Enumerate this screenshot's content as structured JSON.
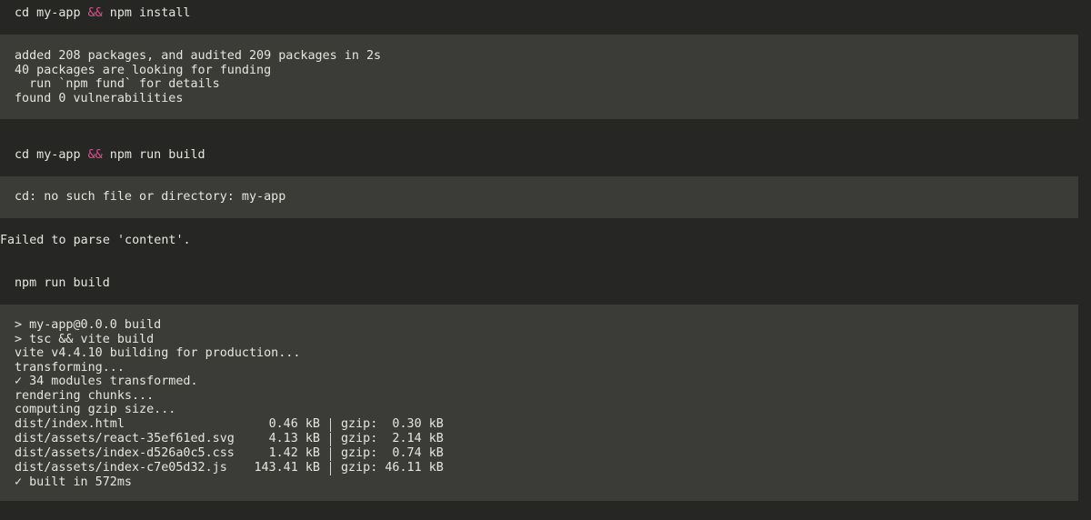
{
  "block1": {
    "cmd_pre": "cd my-app ",
    "cmd_amp": "&&",
    "cmd_post": " npm install",
    "output": [
      "added 208 packages, and audited 209 packages in 2s",
      "40 packages are looking for funding",
      "  run `npm fund` for details",
      "found 0 vulnerabilities"
    ]
  },
  "block2": {
    "cmd_pre": "cd my-app ",
    "cmd_amp": "&&",
    "cmd_post": " npm run build",
    "output": [
      "cd: no such file or directory: my-app"
    ]
  },
  "error_message": "Failed to parse 'content'.",
  "block3": {
    "cmd": "npm run build",
    "output_head": [
      "> my-app@0.0.0 build",
      "> tsc && vite build",
      "vite v4.4.10 building for production...",
      "transforming...",
      "✓ 34 modules transformed.",
      "rendering chunks...",
      "computing gzip size..."
    ],
    "files": [
      {
        "file": "dist/index.html",
        "size": "0.46 kB",
        "gzip": "gzip:  0.30 kB"
      },
      {
        "file": "dist/assets/react-35ef61ed.svg",
        "size": "4.13 kB",
        "gzip": "gzip:  2.14 kB"
      },
      {
        "file": "dist/assets/index-d526a0c5.css",
        "size": "1.42 kB",
        "gzip": "gzip:  0.74 kB"
      },
      {
        "file": "dist/assets/index-c7e05d32.js",
        "size": "143.41 kB",
        "gzip": "gzip: 46.11 kB"
      }
    ],
    "output_tail": "✓ built in 572ms"
  },
  "colors": {
    "background": "#262624",
    "output_background": "#3b3b38",
    "operator": "#e0508a"
  }
}
